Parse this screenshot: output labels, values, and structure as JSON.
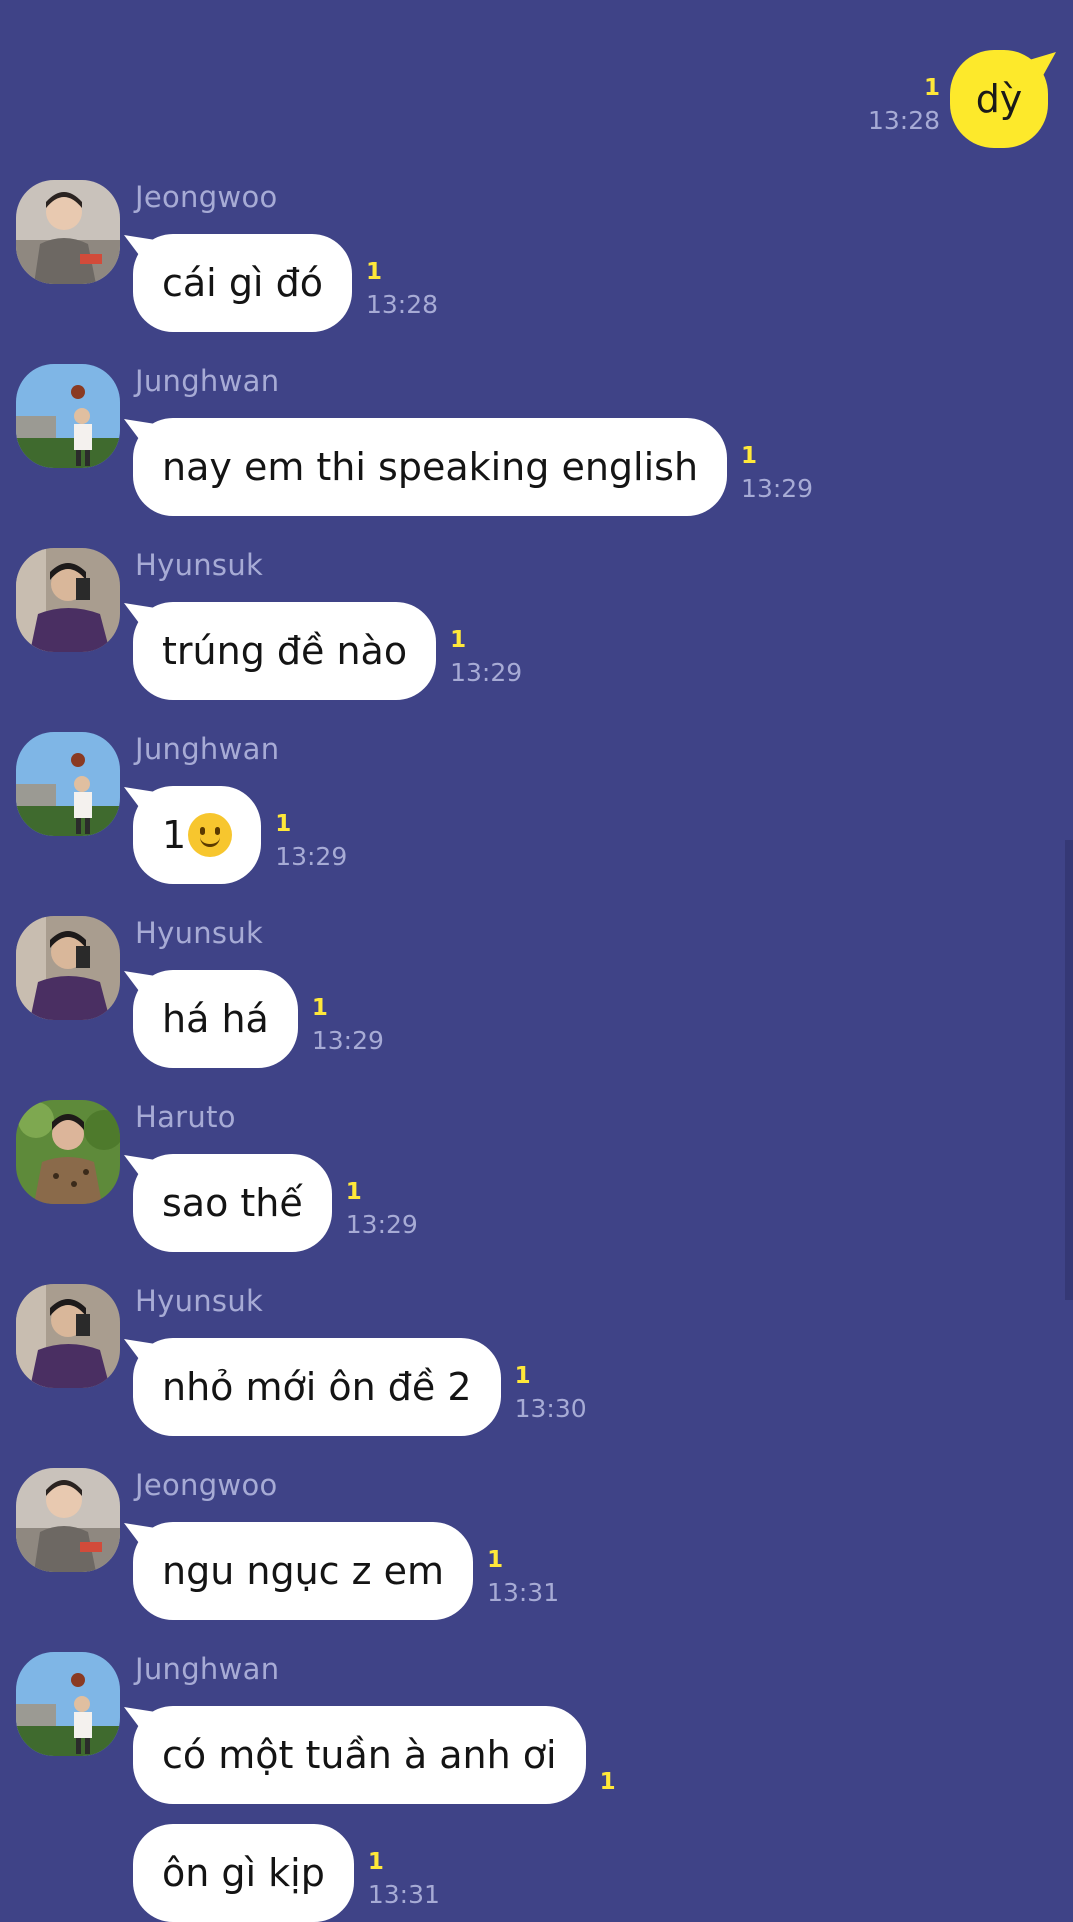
{
  "outgoing": {
    "text": "dỳ",
    "unread": "1",
    "time": "13:28"
  },
  "messages": [
    {
      "sender": "Jeongwoo",
      "avatar": "avatar-jeongwoo",
      "bubbles": [
        {
          "text": "cái gì đó",
          "unread": "1",
          "time": "13:28"
        }
      ]
    },
    {
      "sender": "Junghwan",
      "avatar": "avatar-junghwan",
      "bubbles": [
        {
          "text": "nay em thi speaking english",
          "unread": "1",
          "time": "13:29"
        }
      ]
    },
    {
      "sender": "Hyunsuk",
      "avatar": "avatar-hyunsuk",
      "bubbles": [
        {
          "text": "trúng đề nào",
          "unread": "1",
          "time": "13:29"
        }
      ]
    },
    {
      "sender": "Junghwan",
      "avatar": "avatar-junghwan",
      "bubbles": [
        {
          "text": "1",
          "emoji": "slightly-smiling-face",
          "unread": "1",
          "time": "13:29"
        }
      ]
    },
    {
      "sender": "Hyunsuk",
      "avatar": "avatar-hyunsuk",
      "bubbles": [
        {
          "text": "há há",
          "unread": "1",
          "time": "13:29"
        }
      ]
    },
    {
      "sender": "Haruto",
      "avatar": "avatar-haruto",
      "bubbles": [
        {
          "text": "sao thế",
          "unread": "1",
          "time": "13:29"
        }
      ]
    },
    {
      "sender": "Hyunsuk",
      "avatar": "avatar-hyunsuk",
      "bubbles": [
        {
          "text": "nhỏ mới ôn đề 2",
          "unread": "1",
          "time": "13:30"
        }
      ]
    },
    {
      "sender": "Jeongwoo",
      "avatar": "avatar-jeongwoo",
      "bubbles": [
        {
          "text": "ngu ngục z em",
          "unread": "1",
          "time": "13:31"
        }
      ]
    },
    {
      "sender": "Junghwan",
      "avatar": "avatar-junghwan",
      "bubbles": [
        {
          "text": "có một tuần à anh ơi",
          "unread": "1",
          "time": ""
        },
        {
          "text": "ôn gì kịp",
          "unread": "1",
          "time": "13:31"
        }
      ]
    }
  ],
  "colors": {
    "background": "#3f4387",
    "outgoing_bubble": "#fde92b",
    "incoming_bubble": "#ffffff",
    "unread": "#ffe83a",
    "meta_text": "#a7abd5"
  }
}
